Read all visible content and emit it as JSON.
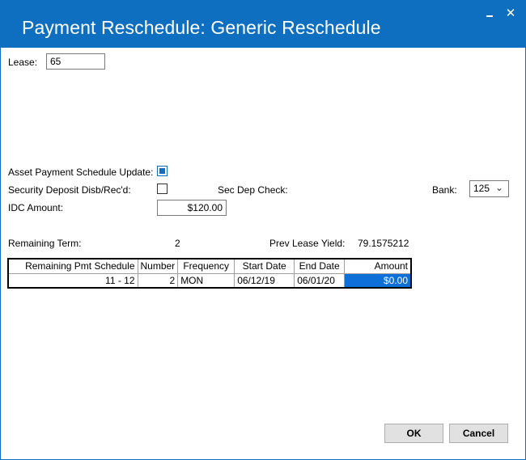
{
  "window": {
    "title": "Payment Reschedule: Generic Reschedule"
  },
  "titlebar": {
    "minimize": "▁",
    "close": "✕"
  },
  "lease": {
    "label": "Lease:",
    "value": "65"
  },
  "asset_update": {
    "label": "Asset Payment Schedule Update:",
    "checked": true
  },
  "security_deposit": {
    "label": "Security Deposit Disb/Rec'd:",
    "checked": false
  },
  "sec_dep_check": {
    "label": "Sec Dep Check:"
  },
  "bank": {
    "label": "Bank:",
    "value": "125"
  },
  "idc_amount": {
    "label": "IDC Amount:",
    "value": "$120.00"
  },
  "remaining_term": {
    "label": "Remaining Term:",
    "value": "2"
  },
  "prev_lease_yield": {
    "label": "Prev Lease Yield:",
    "value": "79.1575212"
  },
  "grid": {
    "headers": [
      "Remaining Pmt Schedule",
      "Number",
      "Frequency",
      "Start Date",
      "End Date",
      "Amount"
    ],
    "rows": [
      [
        "11 - 12",
        "2",
        "MON",
        "06/12/19",
        "06/01/20",
        "$0.00"
      ]
    ]
  },
  "buttons": {
    "ok": "OK",
    "cancel": "Cancel"
  },
  "colors": {
    "accent": "#0e6fc0",
    "selection": "#0f6fd8"
  }
}
